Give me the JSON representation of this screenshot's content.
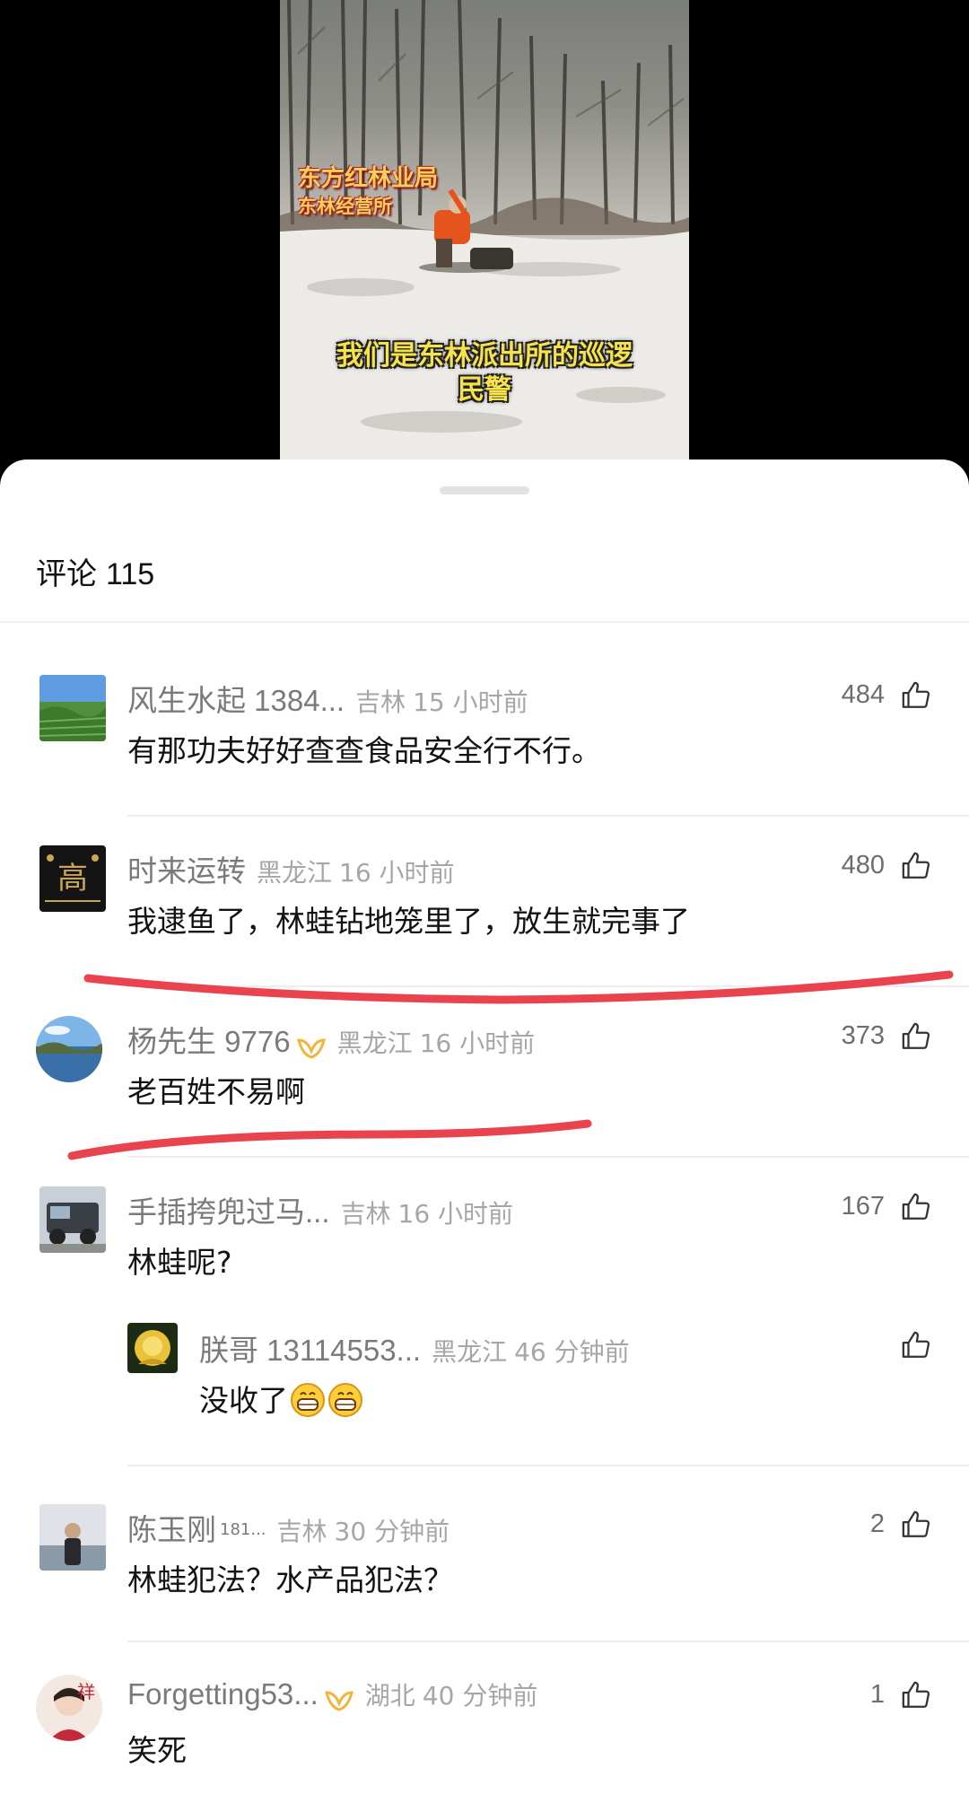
{
  "video": {
    "watermark_line1": "东方红林业局",
    "watermark_line2": "东林经营所",
    "subtitle_line1": "我们是东林派出所的巡逻",
    "subtitle_line2": "民警"
  },
  "sheet": {
    "title_label": "评论",
    "comment_count": "115"
  },
  "comments": [
    {
      "user": "风生水起 1384...",
      "location": "吉林",
      "time": "15 小时前",
      "likes": "484",
      "text": "有那功夫好好查查食品安全行不行。"
    },
    {
      "user": "时来运转",
      "location": "黑龙江",
      "time": "16 小时前",
      "likes": "480",
      "text": "我逮鱼了，林蛙钻地笼里了，放生就完事了"
    },
    {
      "user": "杨先生 9776",
      "location": "黑龙江",
      "time": "16 小时前",
      "likes": "373",
      "text": "老百姓不易啊"
    },
    {
      "user": "手插挎兜过马...",
      "location": "吉林",
      "time": "16 小时前",
      "likes": "167",
      "text": "林蛙呢?"
    },
    {
      "user": "朕哥 13114553...",
      "location": "黑龙江",
      "time": "46 分钟前",
      "likes": "",
      "text": "没收了"
    },
    {
      "user": "陈玉刚",
      "user_sup": "181...",
      "location": "吉林",
      "time": "30 分钟前",
      "likes": "2",
      "text": "林蛙犯法？水产品犯法？"
    },
    {
      "user": "Forgetting53...",
      "location": "湖北",
      "time": "40 分钟前",
      "likes": "1",
      "text": "笑死"
    }
  ],
  "avatar_4_char": "高",
  "avatar_7_char": "祥",
  "icons": {
    "like": "thumb-up-icon",
    "badge": "vip-badge-icon",
    "emoji": "grin-emoji-icon"
  },
  "colors": {
    "annotation_red": "#e8434e",
    "badge_gold": "#f0b53a"
  }
}
